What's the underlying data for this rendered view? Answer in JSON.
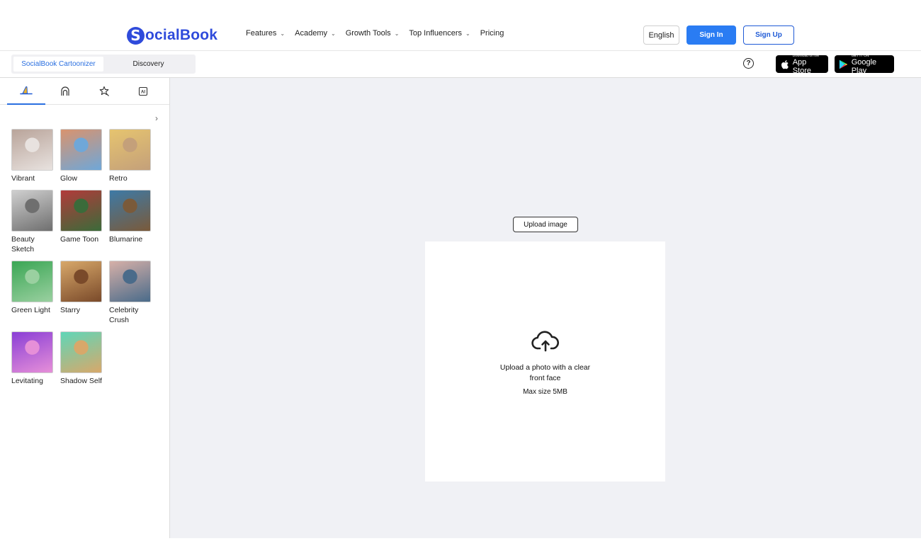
{
  "brand": {
    "logo_letter": "S",
    "logo_text": "ocialBook"
  },
  "nav": {
    "items": [
      {
        "label": "Features",
        "dropdown": true
      },
      {
        "label": "Academy",
        "dropdown": true
      },
      {
        "label": "Growth Tools",
        "dropdown": true
      },
      {
        "label": "Top Influencers",
        "dropdown": true
      },
      {
        "label": "Pricing",
        "dropdown": false
      }
    ],
    "language": "English",
    "sign_in": "Sign In",
    "sign_up": "Sign Up"
  },
  "subbar": {
    "tabs": [
      {
        "label": "SocialBook Cartoonizer",
        "active": true
      },
      {
        "label": "Discovery",
        "active": false
      }
    ],
    "help_symbol": "?",
    "app_store": {
      "small": "Download on the",
      "big": "App Store"
    },
    "google_play": {
      "small": "GET IT ON",
      "big": "Google Play"
    }
  },
  "left_panel": {
    "icon_tabs": [
      "hat-icon",
      "face-outline-icon",
      "magic-star-icon",
      "ai-chip-icon"
    ],
    "ai_chip_text": "AI",
    "styles": [
      {
        "label": "Vibrant",
        "colors": [
          "#b9a49a",
          "#e8e2df"
        ]
      },
      {
        "label": "Glow",
        "colors": [
          "#d9936e",
          "#6fa7d8"
        ]
      },
      {
        "label": "Retro",
        "colors": [
          "#e6c46f",
          "#c4a07a"
        ]
      },
      {
        "label": "Beauty Sketch",
        "colors": [
          "#cfcfcf",
          "#6f6f6f"
        ]
      },
      {
        "label": "Game Toon",
        "colors": [
          "#b23a3a",
          "#3b6b3a"
        ]
      },
      {
        "label": "Blumarine",
        "colors": [
          "#3d7aa6",
          "#7a5a3a"
        ]
      },
      {
        "label": "Green Light",
        "colors": [
          "#3aa654",
          "#9ad0a0"
        ]
      },
      {
        "label": "Starry",
        "colors": [
          "#d8a86a",
          "#7a4a2a"
        ]
      },
      {
        "label": "Celebrity Crush",
        "colors": [
          "#d6b0a8",
          "#4a6b8a"
        ]
      },
      {
        "label": "Levitating",
        "colors": [
          "#8a3fd6",
          "#e68fd8"
        ]
      },
      {
        "label": "Shadow Self",
        "colors": [
          "#5fd6b8",
          "#d8a86a"
        ]
      }
    ]
  },
  "main": {
    "upload_button": "Upload image",
    "drop_text": "Upload a photo with a clear front face",
    "max_size": "Max size 5MB"
  }
}
